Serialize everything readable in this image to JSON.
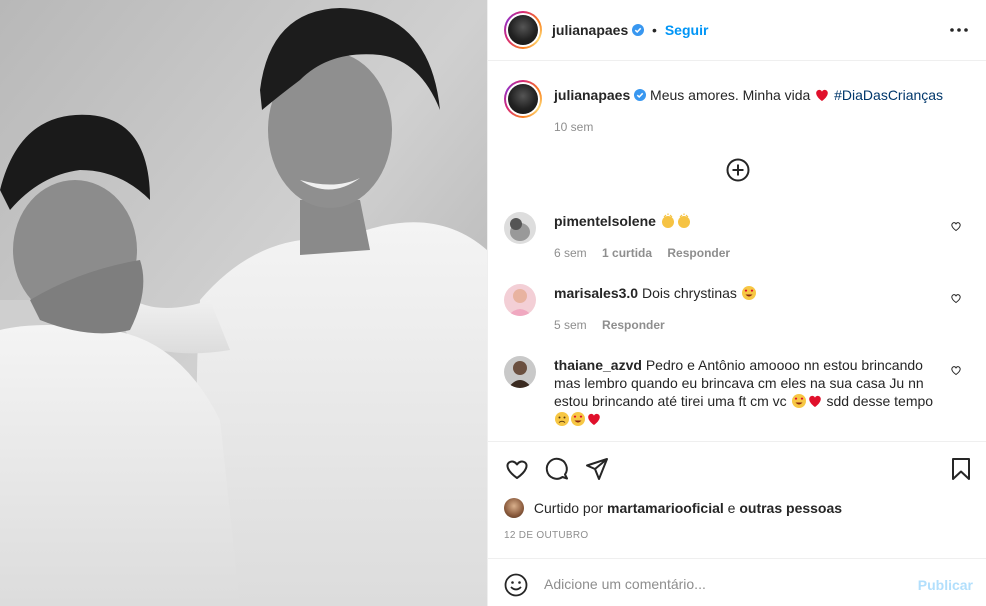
{
  "post": {
    "photo_alt": "Foto em preto e branco de dois meninos de camisa branca",
    "author": {
      "username": "julianapaes",
      "verified": true,
      "follow_label": "Seguir"
    },
    "caption": {
      "username": "julianapaes",
      "text": "Meus amores. Minha vida",
      "hashtag": "#DiaDasCrianças",
      "time": "10 sem"
    },
    "comments": [
      {
        "username": "pimentelsolene",
        "text": "",
        "emojis": [
          "clap-icon",
          "clap-icon"
        ],
        "time": "6 sem",
        "likes": "1 curtida",
        "reply": "Responder"
      },
      {
        "username": "marisales3.0",
        "text": "Dois chrystinas",
        "emojis": [
          "heart-eyes-icon"
        ],
        "time": "5 sem",
        "likes": "",
        "reply": "Responder"
      },
      {
        "username": "thaiane_azvd",
        "text": "Pedro e Antônio amoooo nn estou brincando mas lembro quando eu brincava cm eles na sua casa Ju nn estou brincando até tirei uma ft cm vc",
        "text_after": "sdd desse tempo",
        "emojis": [
          "heart-eyes-icon",
          "red-heart-icon"
        ],
        "emojis_end": [
          "sad-face-icon",
          "heart-eyes-icon",
          "red-heart-icon"
        ]
      }
    ],
    "liked_by": {
      "prefix": "Curtido por",
      "user": "martamariooficial",
      "connector": "e",
      "others": "outras pessoas"
    },
    "date": "12 DE OUTUBRO",
    "add_comment": {
      "placeholder": "Adicione um comentário...",
      "publish_label": "Publicar"
    }
  },
  "colors": {
    "link": "#0095f6",
    "hashtag": "#00376b",
    "muted": "#8e8e8e",
    "publish_disabled": "#b2dffc",
    "heart": "#ed4956"
  }
}
